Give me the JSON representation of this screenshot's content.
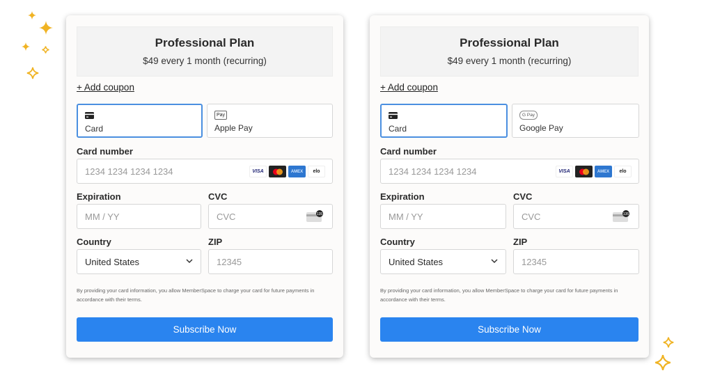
{
  "accent_color": "#2a84ef",
  "sparkle_color": "#f0b323",
  "panels": [
    {
      "plan": {
        "title": "Professional Plan",
        "price": "$49 every 1 month (recurring)"
      },
      "coupon_link": "+ Add coupon",
      "methods": [
        {
          "label": "Card",
          "icon": "credit-card-icon",
          "selected": true
        },
        {
          "label": "Apple Pay",
          "icon": "apple-pay-icon",
          "icon_text": "Pay",
          "selected": false
        }
      ],
      "card_number": {
        "label": "Card number",
        "placeholder": "1234 1234 1234 1234",
        "brands": [
          "VISA",
          "Mastercard",
          "AMEX",
          "elo"
        ]
      },
      "expiration": {
        "label": "Expiration",
        "placeholder": "MM / YY"
      },
      "cvc": {
        "label": "CVC",
        "placeholder": "CVC",
        "icon_text": "135"
      },
      "country": {
        "label": "Country",
        "value": "United States"
      },
      "zip": {
        "label": "ZIP",
        "placeholder": "12345"
      },
      "terms": "By providing your card information, you allow MemberSpace to charge your card for future payments in accordance with their terms.",
      "submit": "Subscribe Now"
    },
    {
      "plan": {
        "title": "Professional Plan",
        "price": "$49 every 1 month (recurring)"
      },
      "coupon_link": "+ Add coupon",
      "methods": [
        {
          "label": "Card",
          "icon": "credit-card-icon",
          "selected": true
        },
        {
          "label": "Google Pay",
          "icon": "google-pay-icon",
          "icon_text": "G Pay",
          "selected": false
        }
      ],
      "card_number": {
        "label": "Card number",
        "placeholder": "1234 1234 1234 1234",
        "brands": [
          "VISA",
          "Mastercard",
          "AMEX",
          "elo"
        ]
      },
      "expiration": {
        "label": "Expiration",
        "placeholder": "MM / YY"
      },
      "cvc": {
        "label": "CVC",
        "placeholder": "CVC",
        "icon_text": "135"
      },
      "country": {
        "label": "Country",
        "value": "United States"
      },
      "zip": {
        "label": "ZIP",
        "placeholder": "12345"
      },
      "terms": "By providing your card information, you allow MemberSpace to charge your card for future payments in accordance with their terms.",
      "submit": "Subscribe Now"
    }
  ]
}
